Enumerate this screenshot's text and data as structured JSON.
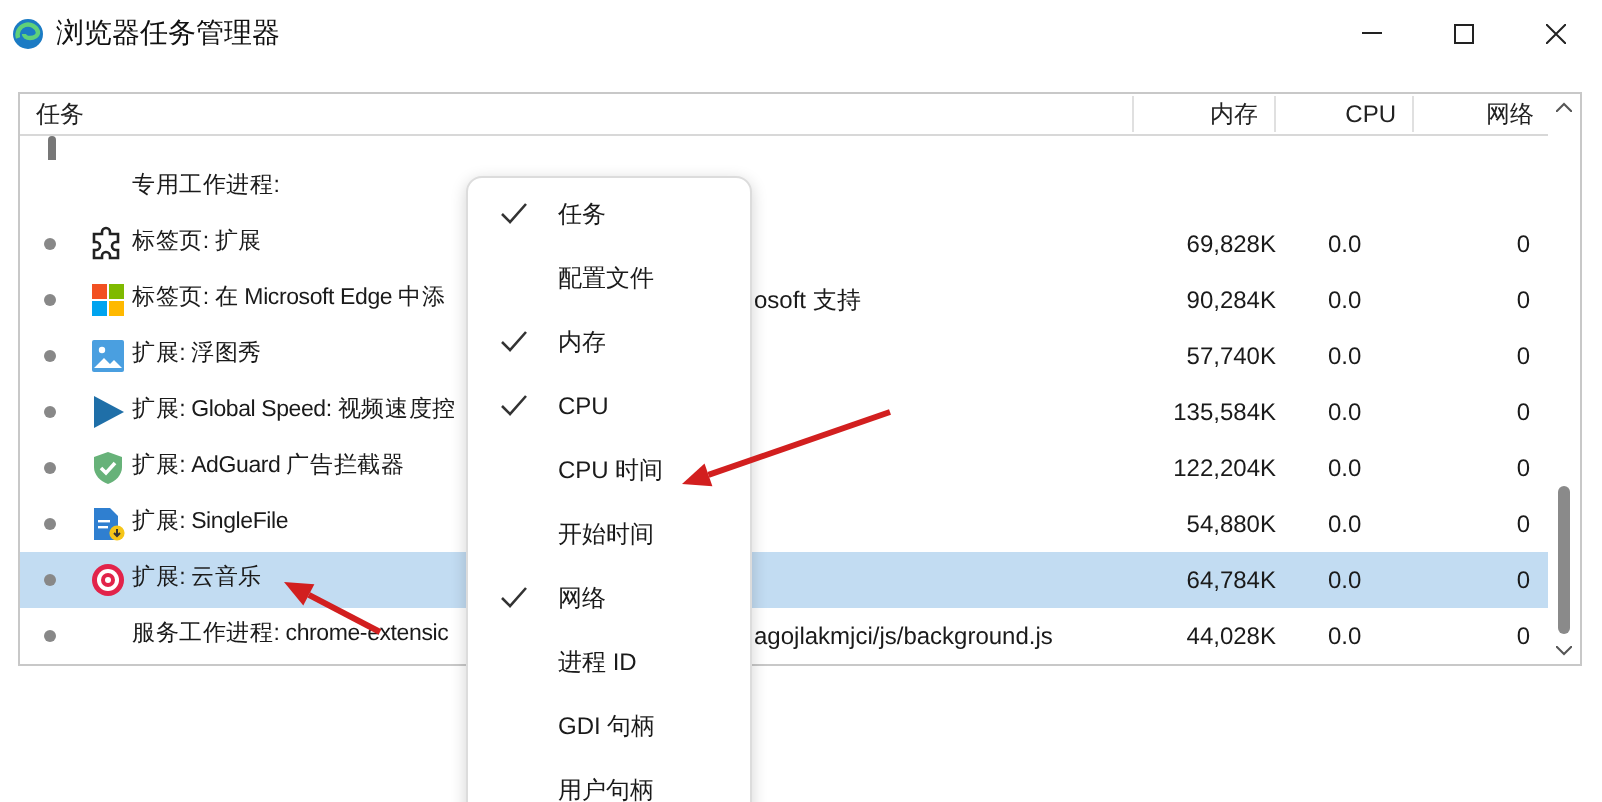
{
  "window": {
    "title": "浏览器任务管理器"
  },
  "table": {
    "columns": [
      "任务",
      "内存",
      "CPU",
      "网络"
    ],
    "rows": [
      {
        "kind": "group",
        "task": "专用工作进程:",
        "selected": false
      },
      {
        "kind": "process",
        "task": "标签页: 扩展",
        "memory": "69,828K",
        "cpu": "0.0",
        "network": "0",
        "selected": false
      },
      {
        "kind": "process",
        "task": "标签页: 在 Microsoft Edge 中添",
        "task_tail": "osoft 支持",
        "memory": "90,284K",
        "cpu": "0.0",
        "network": "0",
        "selected": false
      },
      {
        "kind": "process",
        "task": "扩展: 浮图秀",
        "memory": "57,740K",
        "cpu": "0.0",
        "network": "0",
        "selected": false
      },
      {
        "kind": "process",
        "task": "扩展: Global Speed: 视频速度控",
        "memory": "135,584K",
        "cpu": "0.0",
        "network": "0",
        "selected": false
      },
      {
        "kind": "process",
        "task": "扩展: AdGuard 广告拦截器",
        "memory": "122,204K",
        "cpu": "0.0",
        "network": "0",
        "selected": false
      },
      {
        "kind": "process",
        "task": "扩展: SingleFile",
        "memory": "54,880K",
        "cpu": "0.0",
        "network": "0",
        "selected": false
      },
      {
        "kind": "process",
        "task": "扩展: 云音乐",
        "memory": "64,784K",
        "cpu": "0.0",
        "network": "0",
        "selected": true
      },
      {
        "kind": "process",
        "task": "服务工作进程: chrome-extensic",
        "task_tail": "agojlakmjci/js/background.js",
        "memory": "44,028K",
        "cpu": "0.0",
        "network": "0",
        "selected": false
      }
    ]
  },
  "context_menu": {
    "items": [
      {
        "label": "任务",
        "checked": true
      },
      {
        "label": "配置文件",
        "checked": false
      },
      {
        "label": "内存",
        "checked": true
      },
      {
        "label": "CPU",
        "checked": true
      },
      {
        "label": "CPU 时间",
        "checked": false
      },
      {
        "label": "开始时间",
        "checked": false
      },
      {
        "label": "网络",
        "checked": true
      },
      {
        "label": "进程 ID",
        "checked": false
      },
      {
        "label": "GDI 句柄",
        "checked": false
      },
      {
        "label": "用户句柄",
        "checked": false
      }
    ]
  }
}
